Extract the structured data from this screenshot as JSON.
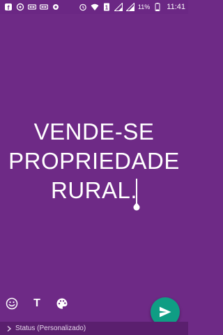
{
  "status_bar": {
    "left_icons": [
      "facebook-icon",
      "sync-icon",
      "voicemail-icon",
      "voicemail-icon",
      "settings-icon"
    ],
    "right_icons": [
      "alarm-icon",
      "wifi-icon",
      "sim-icon",
      "signal-icon",
      "signal-icon",
      "battery-icon"
    ],
    "battery_percent": "11%",
    "time": "11:41"
  },
  "status": {
    "lines": [
      "VENDE-SE",
      "PROPRIEDADE",
      "RURAL."
    ]
  },
  "toolbar": {
    "emoji_icon": "emoji-icon",
    "text_label": "T",
    "palette_icon": "palette-icon"
  },
  "send_button": {
    "icon": "send-icon",
    "color": "#0f9d84"
  },
  "footer": {
    "label": "Status (Personalizado)"
  },
  "colors": {
    "background": "#6e2a86",
    "footer_bg": "#5a1f6e"
  }
}
